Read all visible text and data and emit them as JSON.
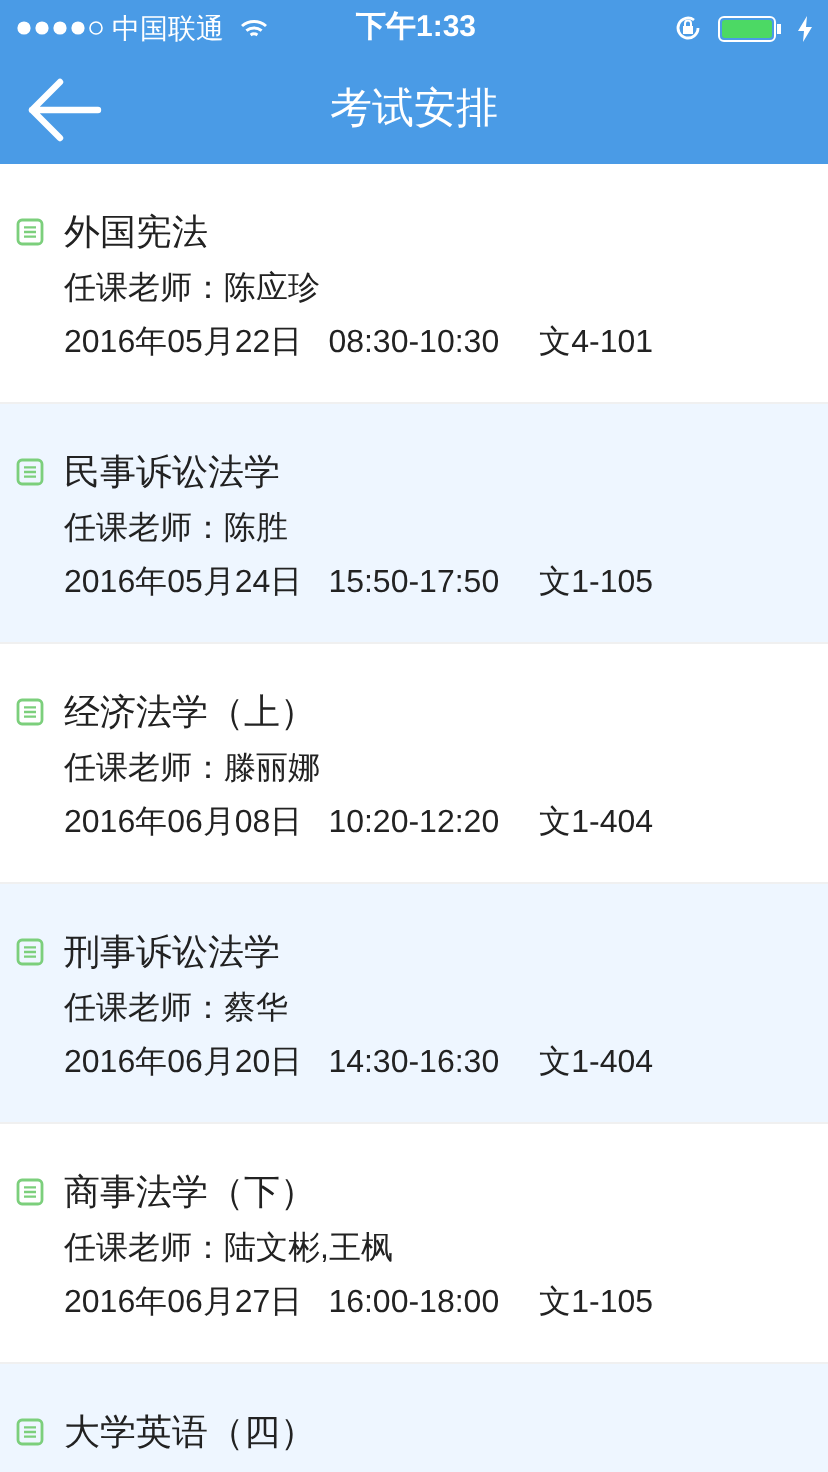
{
  "status_bar": {
    "carrier": "中国联通",
    "time": "下午1:33"
  },
  "nav": {
    "title": "考试安排"
  },
  "exams": [
    {
      "course": "外国宪法",
      "teacher": "任课老师：陈应珍",
      "date": "2016年05月22日",
      "time": "08:30-10:30",
      "room": "文4-101"
    },
    {
      "course": "民事诉讼法学",
      "teacher": "任课老师：陈胜",
      "date": "2016年05月24日",
      "time": "15:50-17:50",
      "room": "文1-105"
    },
    {
      "course": "经济法学（上）",
      "teacher": "任课老师：滕丽娜",
      "date": "2016年06月08日",
      "time": "10:20-12:20",
      "room": "文1-404"
    },
    {
      "course": "刑事诉讼法学",
      "teacher": "任课老师：蔡华",
      "date": "2016年06月20日",
      "time": "14:30-16:30",
      "room": "文1-404"
    },
    {
      "course": "商事法学（下）",
      "teacher": "任课老师：陆文彬,王枫",
      "date": "2016年06月27日",
      "time": "16:00-18:00",
      "room": "文1-105"
    },
    {
      "course": "大学英语（四）"
    }
  ]
}
